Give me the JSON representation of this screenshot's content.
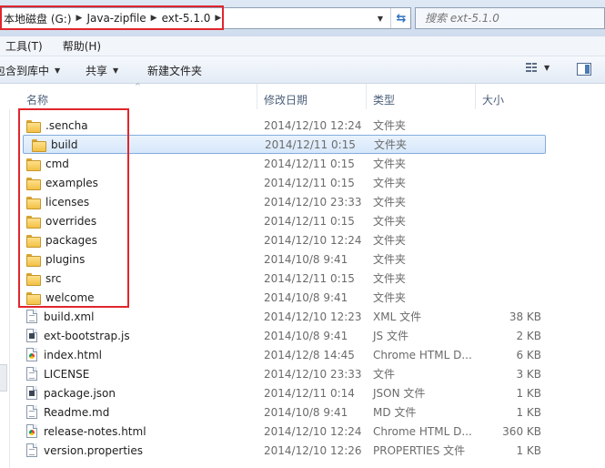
{
  "breadcrumb": {
    "drive": "本地磁盘 (G:)",
    "folder1": "Java-zipfile",
    "folder2": "ext-5.1.0"
  },
  "search": {
    "placeholder": "搜索 ext-5.1.0"
  },
  "menu": {
    "tools": "工具(T)",
    "help": "帮助(H)"
  },
  "commands": {
    "include_library": "包含到库中",
    "share": "共享",
    "new_folder": "新建文件夹"
  },
  "columns": {
    "name": "名称",
    "date": "修改日期",
    "type": "类型",
    "size": "大小"
  },
  "files": [
    {
      "name": ".sencha",
      "date": "2014/12/10 12:24",
      "type": "文件夹",
      "size": "",
      "icon": "folder-icon"
    },
    {
      "name": "build",
      "date": "2014/12/11 0:15",
      "type": "文件夹",
      "size": "",
      "icon": "folder-icon",
      "selected": true
    },
    {
      "name": "cmd",
      "date": "2014/12/11 0:15",
      "type": "文件夹",
      "size": "",
      "icon": "folder-icon"
    },
    {
      "name": "examples",
      "date": "2014/12/11 0:15",
      "type": "文件夹",
      "size": "",
      "icon": "folder-icon"
    },
    {
      "name": "licenses",
      "date": "2014/12/10 23:33",
      "type": "文件夹",
      "size": "",
      "icon": "folder-icon"
    },
    {
      "name": "overrides",
      "date": "2014/12/11 0:15",
      "type": "文件夹",
      "size": "",
      "icon": "folder-icon"
    },
    {
      "name": "packages",
      "date": "2014/12/10 12:24",
      "type": "文件夹",
      "size": "",
      "icon": "folder-icon"
    },
    {
      "name": "plugins",
      "date": "2014/10/8 9:41",
      "type": "文件夹",
      "size": "",
      "icon": "folder-icon"
    },
    {
      "name": "src",
      "date": "2014/12/11 0:15",
      "type": "文件夹",
      "size": "",
      "icon": "folder-icon"
    },
    {
      "name": "welcome",
      "date": "2014/10/8 9:41",
      "type": "文件夹",
      "size": "",
      "icon": "folder-icon"
    },
    {
      "name": "build.xml",
      "date": "2014/12/10 12:23",
      "type": "XML 文件",
      "size": "38 KB",
      "icon": "file-icon"
    },
    {
      "name": "ext-bootstrap.js",
      "date": "2014/10/8 9:41",
      "type": "JS 文件",
      "size": "2 KB",
      "icon": "file-icon"
    },
    {
      "name": "index.html",
      "date": "2014/12/8 14:45",
      "type": "Chrome HTML D...",
      "size": "6 KB",
      "icon": "chrome-file-icon"
    },
    {
      "name": "LICENSE",
      "date": "2014/12/10 23:33",
      "type": "文件",
      "size": "3 KB",
      "icon": "file-icon"
    },
    {
      "name": "package.json",
      "date": "2014/12/11 0:14",
      "type": "JSON 文件",
      "size": "1 KB",
      "icon": "file-icon"
    },
    {
      "name": "Readme.md",
      "date": "2014/10/8 9:41",
      "type": "MD 文件",
      "size": "1 KB",
      "icon": "file-icon"
    },
    {
      "name": "release-notes.html",
      "date": "2014/12/10 12:24",
      "type": "Chrome HTML D...",
      "size": "360 KB",
      "icon": "chrome-file-icon"
    },
    {
      "name": "version.properties",
      "date": "2014/12/10 12:26",
      "type": "PROPERTIES 文件",
      "size": "1 KB",
      "icon": "file-icon"
    }
  ],
  "colors": {
    "highlight_box": "#e0262d",
    "selection_border": "#84acdd",
    "folder_yellow": "#f2c145"
  }
}
